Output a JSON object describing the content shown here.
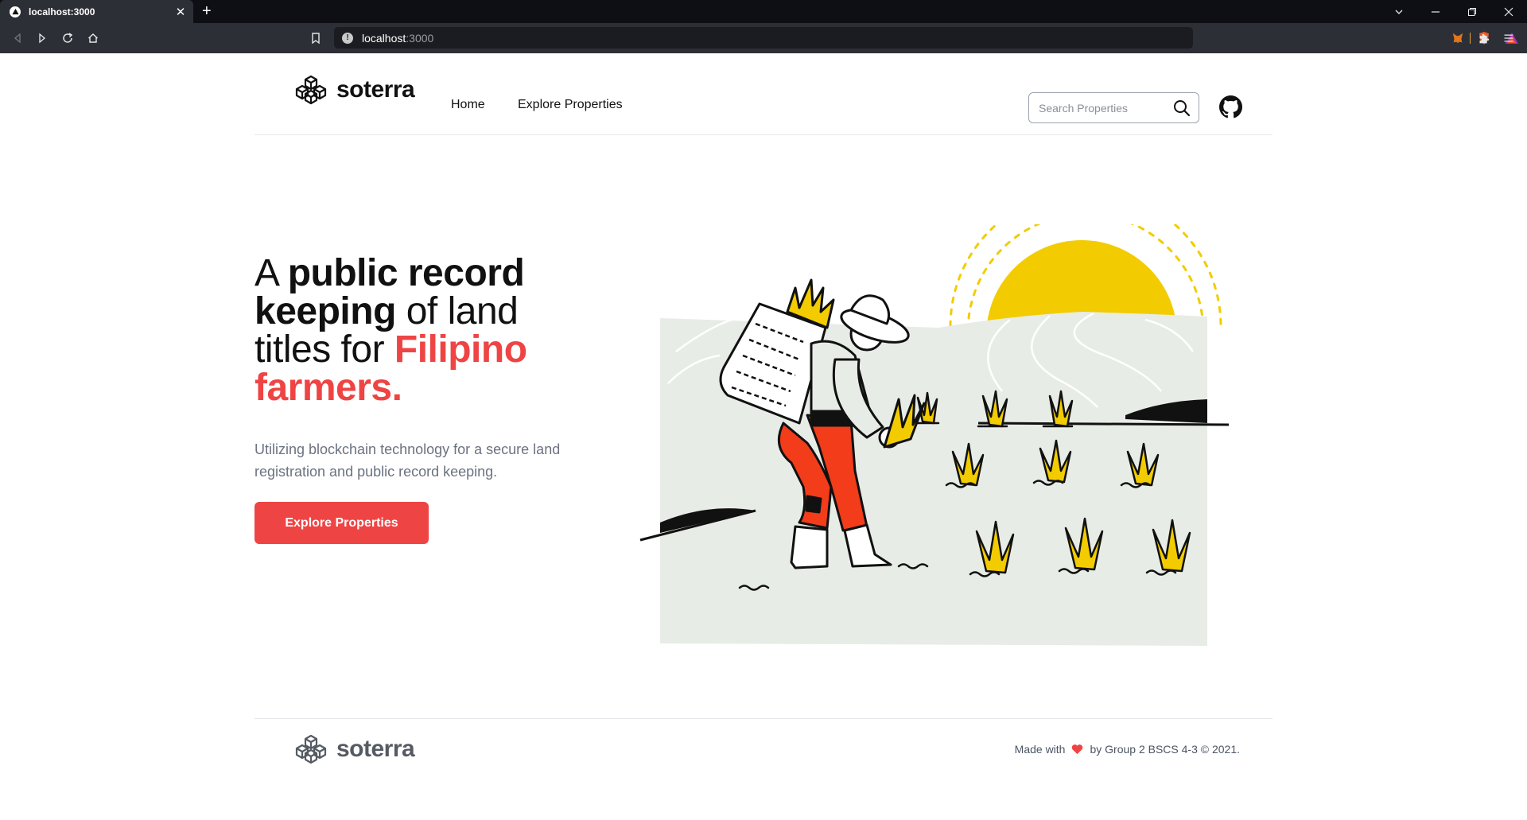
{
  "browser": {
    "tab_title": "localhost:3000",
    "url_host": "localhost",
    "url_port": ":3000"
  },
  "header": {
    "brand": "soterra",
    "nav": [
      "Home",
      "Explore Properties"
    ],
    "search_placeholder": "Search Properties"
  },
  "hero": {
    "title_parts": [
      "A ",
      "public record keeping",
      " of land titles for ",
      "Filipino farmers."
    ],
    "subtitle": "Utilizing blockchain technology for a secure land registration and public record keeping.",
    "cta_label": "Explore Properties"
  },
  "footer": {
    "brand": "soterra",
    "made_with": "Made with",
    "credit": "by Group 2 BSCS 4-3 © 2021."
  },
  "colors": {
    "accent": "#ef4444",
    "sun": "#f2cc00",
    "field": "#e8ece6"
  },
  "icons": [
    "search-icon",
    "github-icon",
    "heart-icon",
    "cube-logo-icon"
  ]
}
